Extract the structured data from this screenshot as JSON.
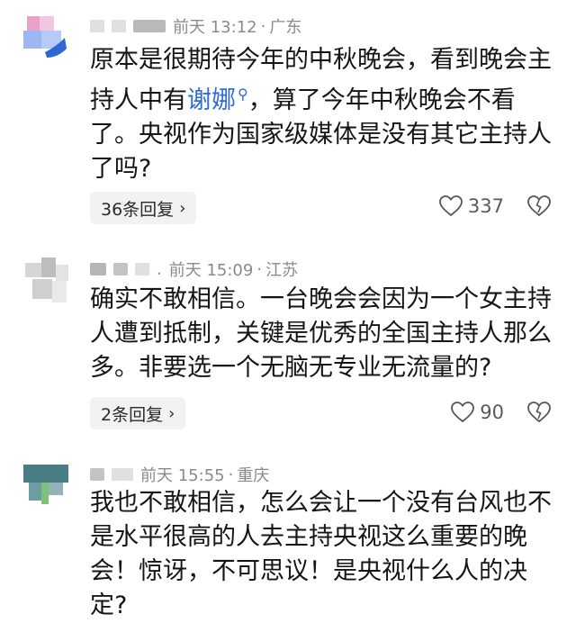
{
  "comments": [
    {
      "time": "前天 13:12",
      "location": "广东",
      "text_before": "原本是很期待今年的中秋晚会，看到晚会主持人中有",
      "mention": "谢娜",
      "text_after": "，算了今年中秋晚会不看了。央视作为国家级媒体是没有其它主持人了吗?",
      "replies_label": "36条回复",
      "likes": "337"
    },
    {
      "time": "前天 15:09",
      "location": "江苏",
      "text": "确实不敢相信。一台晚会会因为一个女主持人遭到抵制，关键是优秀的全国主持人那么多。非要选一个无脑无专业无流量的?",
      "replies_label": "2条回复",
      "likes": "90"
    },
    {
      "time": "前天 15:55",
      "location": "重庆",
      "text": "我也不敢相信，怎么会让一个没有台风也不是水平很高的人去主持央视这么重要的晚会！惊讶，不可思议！是央视什么人的决定?"
    }
  ],
  "icons": {
    "like": "heart-outline-icon",
    "dislike": "broken-heart-icon",
    "mention": "search-icon",
    "chevron": "chevron-right-icon"
  },
  "colors": {
    "mention": "#2d6cd2",
    "meta": "#8a8a8a",
    "reply_bg": "#f2f2f2"
  }
}
